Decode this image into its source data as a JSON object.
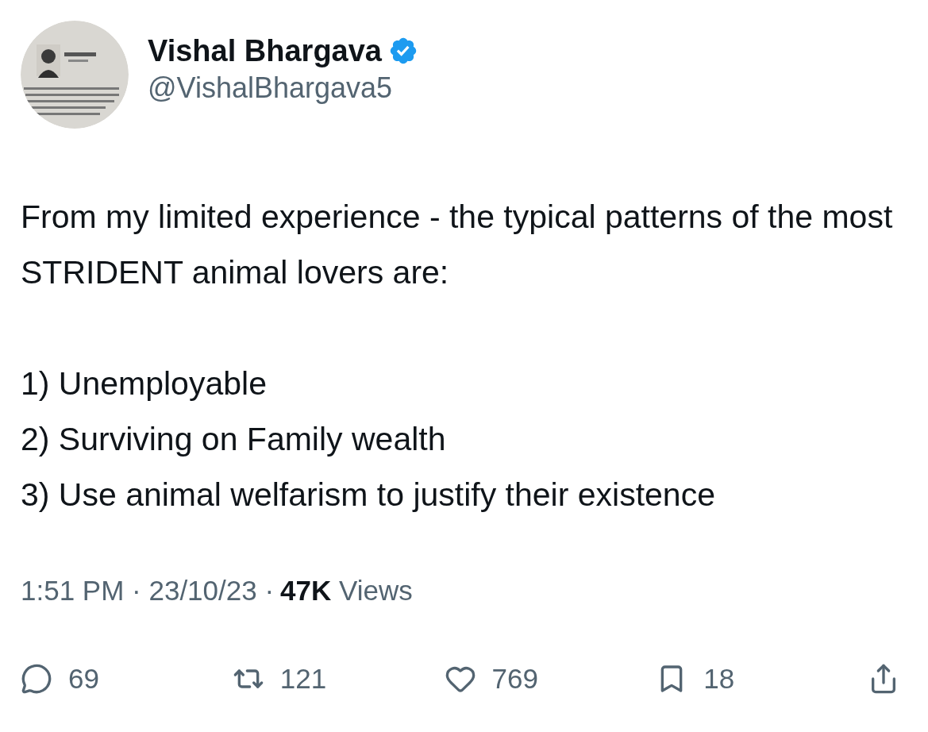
{
  "author": {
    "name": "Vishal Bhargava",
    "verified": true,
    "handle": "@VishalBhargava5"
  },
  "body": "From my limited experience - the typical patterns of the most STRIDENT animal lovers are:\n\n1) Unemployable\n2) Surviving on Family wealth\n3) Use animal welfarism to justify their existence",
  "meta": {
    "timestamp": "1:51 PM · 23/10/23 ·",
    "views": "**47K** Views"
  },
  "actions": [
    {
      "kind": "reply",
      "count": "69"
    },
    {
      "kind": "repost",
      "count": "121"
    },
    {
      "kind": "like",
      "count": "769"
    },
    {
      "kind": "bookmark",
      "count": "18"
    },
    {
      "kind": "share"
    }
  ]
}
